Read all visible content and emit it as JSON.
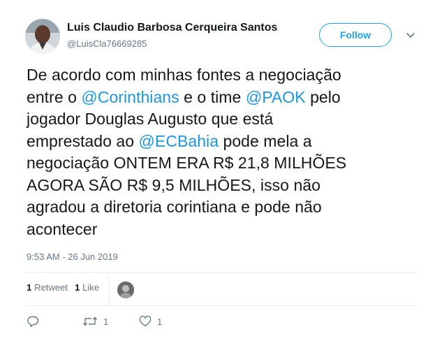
{
  "author": {
    "display_name": "Luis Claudio Barbosa Cerqueira Santos",
    "handle": "@LuisCla76669285"
  },
  "follow_label": "Follow",
  "tweet": {
    "lines": [
      [
        {
          "t": "De acordo com minhas fontes a negociação"
        }
      ],
      [
        {
          "t": "entre o "
        },
        {
          "t": "@Corinthians",
          "m": true
        },
        {
          "t": " e o time "
        },
        {
          "t": "@PAOK",
          "m": true
        },
        {
          "t": " pelo"
        }
      ],
      [
        {
          "t": "jogador Douglas Augusto que está"
        }
      ],
      [
        {
          "t": "emprestado ao "
        },
        {
          "t": "@ECBahia",
          "m": true
        },
        {
          "t": " pode mela a"
        }
      ],
      [
        {
          "t": "negociação ONTEM ERA R$ 21,8 MILHÕES"
        }
      ],
      [
        {
          "t": "AGORA SÃO R$ 9,5 MILHÕES, isso não"
        }
      ],
      [
        {
          "t": "agradou a diretoria corintiana e pode não"
        }
      ],
      [
        {
          "t": "acontecer"
        }
      ]
    ],
    "timestamp": "9:53 AM - 26 Jun 2019"
  },
  "stats": {
    "retweet_count": "1",
    "retweet_label": "Retweet",
    "like_count": "1",
    "like_label": "Like"
  },
  "actions": {
    "reply_count": "",
    "retweet_count": "1",
    "like_count": "1"
  },
  "colors": {
    "accent": "#1da1f2",
    "mention": "#1b95e0",
    "muted": "#657786",
    "divider": "#e6ecf0"
  },
  "icons": [
    "reply-icon",
    "retweet-icon",
    "heart-icon",
    "caret-down-icon"
  ]
}
